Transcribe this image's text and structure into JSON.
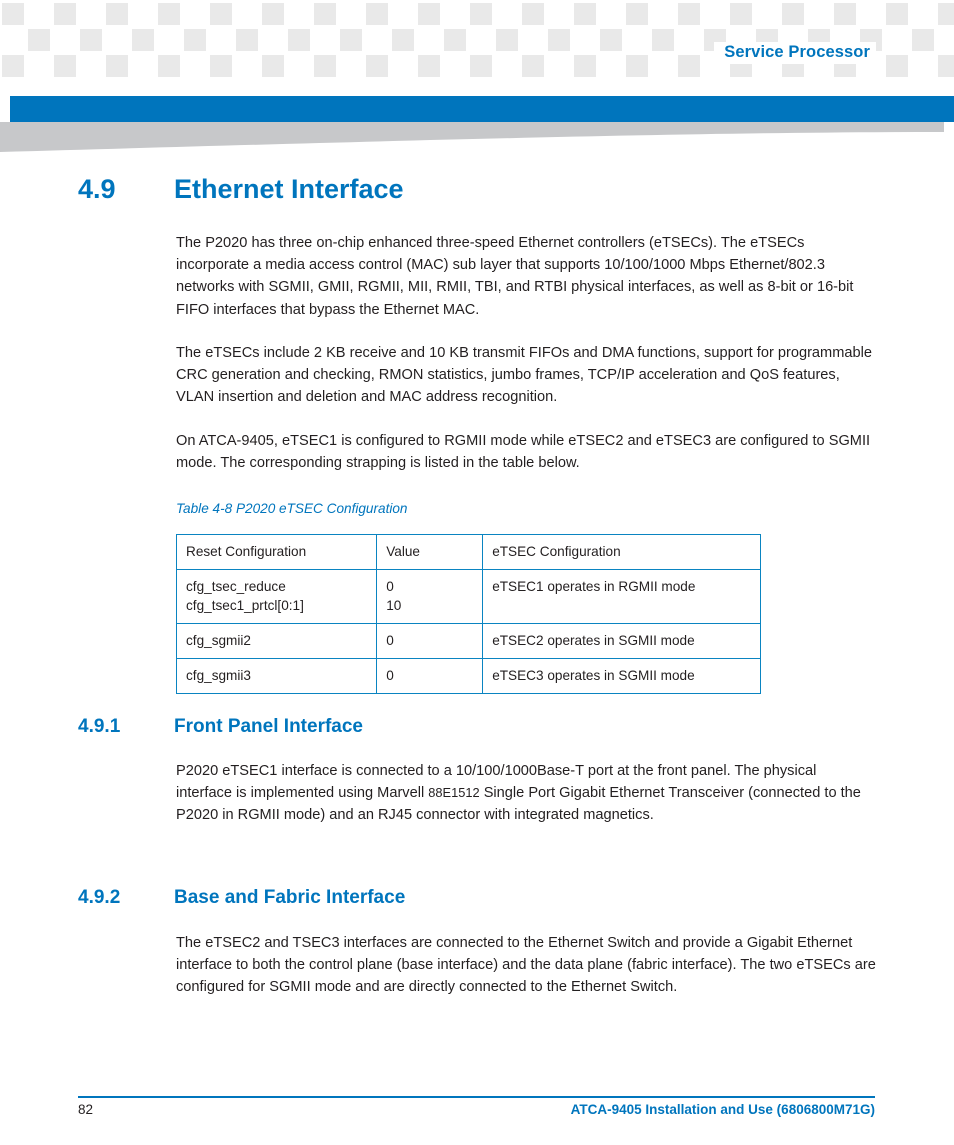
{
  "header": {
    "running_head": "Service Processor"
  },
  "section": {
    "number": "4.9",
    "title": "Ethernet Interface",
    "paragraphs": [
      "The P2020 has three on-chip enhanced three-speed Ethernet controllers (eTSECs). The eTSECs incorporate a media access control (MAC) sub layer that supports 10/100/1000 Mbps Ethernet/802.3 networks with SGMII, GMII, RGMII, MII, RMII, TBI, and RTBI physical interfaces, as well as 8-bit or 16-bit FIFO interfaces that bypass the Ethernet MAC.",
      "The eTSECs include 2 KB receive and 10 KB transmit FIFOs and DMA functions, support for programmable CRC generation and checking, RMON statistics, jumbo frames, TCP/IP acceleration and QoS features, VLAN insertion and deletion and MAC address recognition.",
      "On ATCA-9405, eTSEC1 is configured to RGMII mode while eTSEC2 and eTSEC3 are configured to SGMII mode. The corresponding strapping is listed in the table below."
    ]
  },
  "table": {
    "caption": "Table 4-8 P2020 eTSEC Configuration",
    "headers": [
      "Reset Configuration",
      "Value",
      "eTSEC Configuration"
    ],
    "rows": [
      {
        "reset_configuration": [
          "cfg_tsec_reduce",
          "cfg_tsec1_prtcl[0:1]"
        ],
        "value": [
          "0",
          "10"
        ],
        "etsec_configuration": [
          "eTSEC1 operates in RGMII mode"
        ]
      },
      {
        "reset_configuration": [
          "cfg_sgmii2"
        ],
        "value": [
          "0"
        ],
        "etsec_configuration": [
          "eTSEC2 operates in SGMII mode"
        ]
      },
      {
        "reset_configuration": [
          "cfg_sgmii3"
        ],
        "value": [
          "0"
        ],
        "etsec_configuration": [
          "eTSEC3 operates in SGMII mode"
        ]
      }
    ]
  },
  "subsections": [
    {
      "number": "4.9.1",
      "title": "Front Panel Interface",
      "paragraph_pre": "P2020 eTSEC1 interface is connected to a 10/100/1000Base-T port at the front panel. The physical interface is implemented using Marvell ",
      "paragraph_sc": "88E1512",
      "paragraph_post": " Single Port Gigabit Ethernet Transceiver (connected to the P2020 in RGMII mode) and an RJ45 connector with integrated magnetics."
    },
    {
      "number": "4.9.2",
      "title": "Base and Fabric Interface",
      "paragraph": "The eTSEC2 and TSEC3 interfaces are connected to the Ethernet Switch and provide a Gigabit Ethernet interface to both the control plane (base interface) and the data plane (fabric interface). The two eTSECs are configured for SGMII mode and are directly connected to the Ethernet Switch."
    }
  ],
  "footer": {
    "page_number": "82",
    "document": "ATCA-9405 Installation and Use (6806800M71G)"
  }
}
